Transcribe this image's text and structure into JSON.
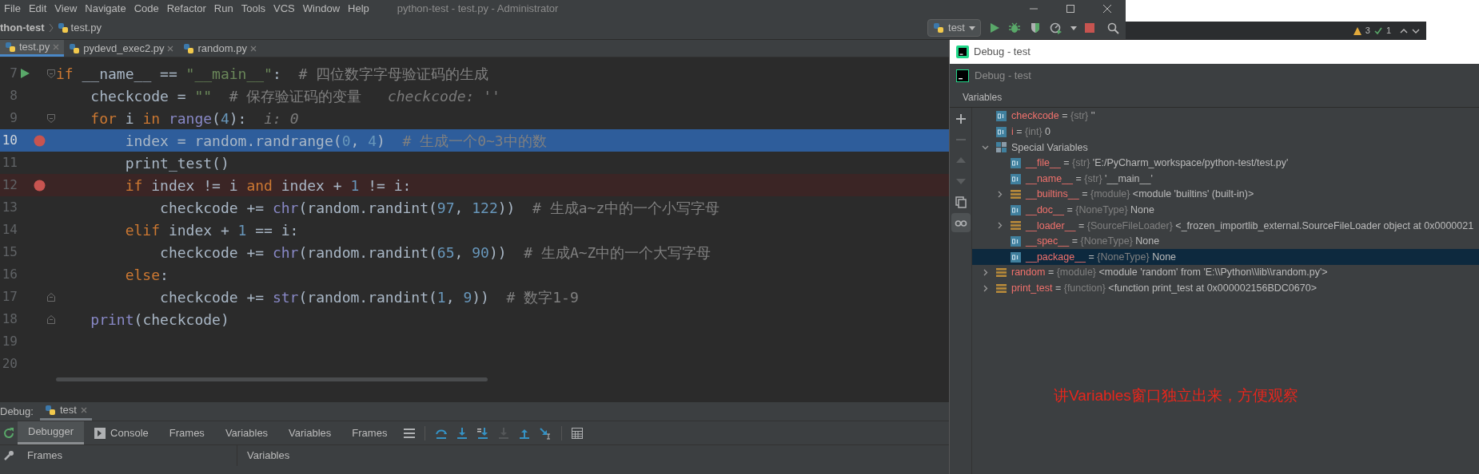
{
  "menu": [
    "File",
    "Edit",
    "View",
    "Navigate",
    "Code",
    "Refactor",
    "Run",
    "Tools",
    "VCS",
    "Window",
    "Help"
  ],
  "window": {
    "title": "python-test - test.py - Administrator"
  },
  "breadcrumb": [
    "thon-test",
    "test.py"
  ],
  "run_config": "test",
  "status_strip": {
    "warnings": "3",
    "checks": "1"
  },
  "editor_tabs": [
    {
      "label": "test.py",
      "selected": true
    },
    {
      "label": "pydevd_exec2.py",
      "selected": false
    },
    {
      "label": "random.py",
      "selected": false
    }
  ],
  "code_lines": [
    {
      "number": "7",
      "run_marker": true,
      "fold_open": true,
      "tokens": [
        {
          "kind": "keyword",
          "text": "if"
        },
        {
          "kind": "plain",
          "text": " __name__ == "
        },
        {
          "kind": "string",
          "text": "\"__main__\""
        },
        {
          "kind": "plain",
          "text": ":"
        },
        {
          "kind": "comment",
          "text": "  # 四位数字字母验证码的生成"
        }
      ]
    },
    {
      "number": "8",
      "tokens": [
        {
          "kind": "plain",
          "text": "    checkcode = "
        },
        {
          "kind": "string",
          "text": "\"\""
        },
        {
          "kind": "comment",
          "text": "  # 保存验证码的变量"
        },
        {
          "kind": "hint",
          "text": "   checkcode: ''"
        }
      ]
    },
    {
      "number": "9",
      "fold_open": true,
      "tokens": [
        {
          "kind": "keyword",
          "text": "    for"
        },
        {
          "kind": "plain",
          "text": " i "
        },
        {
          "kind": "keyword",
          "text": "in"
        },
        {
          "kind": "builtin",
          "text": " range"
        },
        {
          "kind": "plain",
          "text": "("
        },
        {
          "kind": "number",
          "text": "4"
        },
        {
          "kind": "plain",
          "text": "):"
        },
        {
          "kind": "hint",
          "text": "  i: 0"
        }
      ]
    },
    {
      "number": "10",
      "breakpoint": true,
      "current": true,
      "tokens": [
        {
          "kind": "plain",
          "text": "        index = random.randrange("
        },
        {
          "kind": "number",
          "text": "0"
        },
        {
          "kind": "plain",
          "text": ", "
        },
        {
          "kind": "number",
          "text": "4"
        },
        {
          "kind": "plain",
          "text": ")"
        },
        {
          "kind": "comment",
          "text": "  # 生成一个0~3中的数"
        }
      ]
    },
    {
      "number": "11",
      "tokens": [
        {
          "kind": "plain",
          "text": "        print_test()"
        }
      ]
    },
    {
      "number": "12",
      "breakpoint": true,
      "current": false,
      "tokens": [
        {
          "kind": "keyword",
          "text": "        if"
        },
        {
          "kind": "plain",
          "text": " index != i "
        },
        {
          "kind": "keyword",
          "text": "and"
        },
        {
          "kind": "plain",
          "text": " index + "
        },
        {
          "kind": "number",
          "text": "1"
        },
        {
          "kind": "plain",
          "text": " != i:"
        }
      ]
    },
    {
      "number": "13",
      "tokens": [
        {
          "kind": "plain",
          "text": "            checkcode += "
        },
        {
          "kind": "builtin",
          "text": "chr"
        },
        {
          "kind": "plain",
          "text": "(random.randint("
        },
        {
          "kind": "number",
          "text": "97"
        },
        {
          "kind": "plain",
          "text": ", "
        },
        {
          "kind": "number",
          "text": "122"
        },
        {
          "kind": "plain",
          "text": "))"
        },
        {
          "kind": "comment",
          "text": "  # 生成a~z中的一个小写字母"
        }
      ]
    },
    {
      "number": "14",
      "tokens": [
        {
          "kind": "keyword",
          "text": "        elif"
        },
        {
          "kind": "plain",
          "text": " index + "
        },
        {
          "kind": "number",
          "text": "1"
        },
        {
          "kind": "plain",
          "text": " == i:"
        }
      ]
    },
    {
      "number": "15",
      "tokens": [
        {
          "kind": "plain",
          "text": "            checkcode += "
        },
        {
          "kind": "builtin",
          "text": "chr"
        },
        {
          "kind": "plain",
          "text": "(random.randint("
        },
        {
          "kind": "number",
          "text": "65"
        },
        {
          "kind": "plain",
          "text": ", "
        },
        {
          "kind": "number",
          "text": "90"
        },
        {
          "kind": "plain",
          "text": "))"
        },
        {
          "kind": "comment",
          "text": "  # 生成A~Z中的一个大写字母"
        }
      ]
    },
    {
      "number": "16",
      "tokens": [
        {
          "kind": "keyword",
          "text": "        else"
        },
        {
          "kind": "plain",
          "text": ":"
        }
      ]
    },
    {
      "number": "17",
      "fold_close": true,
      "tokens": [
        {
          "kind": "plain",
          "text": "            checkcode += "
        },
        {
          "kind": "builtin",
          "text": "str"
        },
        {
          "kind": "plain",
          "text": "(random.randint("
        },
        {
          "kind": "number",
          "text": "1"
        },
        {
          "kind": "plain",
          "text": ", "
        },
        {
          "kind": "number",
          "text": "9"
        },
        {
          "kind": "plain",
          "text": "))"
        },
        {
          "kind": "comment",
          "text": "  # 数字1-9"
        }
      ]
    },
    {
      "number": "18",
      "fold_close": true,
      "tokens": [
        {
          "kind": "builtin",
          "text": "    print"
        },
        {
          "kind": "plain",
          "text": "(checkcode)"
        }
      ]
    },
    {
      "number": "19"
    },
    {
      "number": "20"
    }
  ],
  "debug_panel": {
    "label": "Debug:",
    "session_tab": "test",
    "tabs": [
      {
        "label": "Debugger",
        "kind": "plain",
        "selected": true
      },
      {
        "label": "Console",
        "kind": "console",
        "selected": false
      },
      {
        "label": "Frames",
        "kind": "plain",
        "selected": false
      },
      {
        "label": "Variables",
        "kind": "plain",
        "selected": false
      },
      {
        "label": "Variables",
        "kind": "plain",
        "selected": false
      },
      {
        "label": "Frames",
        "kind": "plain",
        "selected": false
      }
    ],
    "step_buttons": [
      {
        "kind": "step-over",
        "disabled": false
      },
      {
        "kind": "step-into",
        "disabled": false
      },
      {
        "kind": "step-into-my-code",
        "disabled": false
      },
      {
        "kind": "force-step-into",
        "disabled": true
      },
      {
        "kind": "step-out",
        "disabled": false
      },
      {
        "kind": "run-to-cursor",
        "disabled": false
      }
    ],
    "columns": [
      "Frames",
      "Variables"
    ]
  },
  "debug_window": {
    "title": "Debug - test",
    "header": "Debug - test",
    "panel": "Variables",
    "tools": [
      {
        "kind": "add",
        "disabled": false,
        "selected": false
      },
      {
        "kind": "remove",
        "disabled": true,
        "selected": false
      },
      {
        "kind": "up",
        "disabled": true,
        "selected": false
      },
      {
        "kind": "down",
        "disabled": true,
        "selected": false
      },
      {
        "kind": "copy",
        "disabled": false,
        "selected": false
      },
      {
        "kind": "watches",
        "disabled": false,
        "selected": true
      }
    ],
    "variables": [
      {
        "name": "checkcode",
        "operator": "=",
        "type": "{str}",
        "value": "''",
        "kind": "primitive",
        "selected": false
      },
      {
        "name": "i",
        "operator": "=",
        "type": "{int}",
        "value": "0",
        "kind": "primitive",
        "selected": false
      },
      {
        "name": "Special Variables",
        "kind": "group",
        "expanded": true,
        "selected": false,
        "children": [
          {
            "name": "__file__",
            "operator": "=",
            "type": "{str}",
            "value": "'E:/PyCharm_workspace/python-test/test.py'",
            "kind": "primitive",
            "selected": false
          },
          {
            "name": "__name__",
            "operator": "=",
            "type": "{str}",
            "value": "'__main__'",
            "kind": "primitive",
            "selected": false
          },
          {
            "name": "__builtins__",
            "operator": "=",
            "type": "{module}",
            "value": "<module 'builtins' (built-in)>",
            "kind": "object",
            "expanded": false,
            "selected": false
          },
          {
            "name": "__doc__",
            "operator": "=",
            "type": "{NoneType}",
            "value": "None",
            "kind": "primitive",
            "selected": false
          },
          {
            "name": "__loader__",
            "operator": "=",
            "type": "{SourceFileLoader}",
            "value": "<_frozen_importlib_external.SourceFileLoader object at 0x0000021",
            "kind": "object",
            "expanded": false,
            "selected": false
          },
          {
            "name": "__spec__",
            "operator": "=",
            "type": "{NoneType}",
            "value": "None",
            "kind": "primitive",
            "selected": false
          },
          {
            "name": "__package__",
            "operator": "=",
            "type": "{NoneType}",
            "value": "None",
            "kind": "primitive",
            "selected": true
          }
        ]
      },
      {
        "name": "random",
        "operator": "=",
        "type": "{module}",
        "value": "<module 'random' from 'E:\\\\Python\\\\lib\\\\random.py'>",
        "kind": "object",
        "expanded": false,
        "selected": false
      },
      {
        "name": "print_test",
        "operator": "=",
        "type": "{function}",
        "value": "<function print_test at 0x000002156BDC0670>",
        "kind": "object",
        "expanded": false,
        "selected": false
      }
    ]
  },
  "annotation": "讲Variables窗口独立出来，方便观察"
}
